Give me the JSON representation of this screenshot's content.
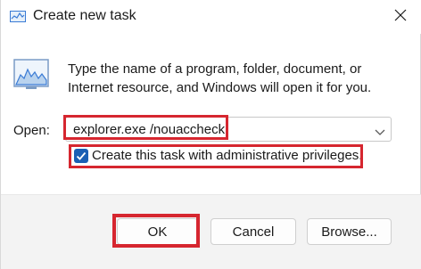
{
  "window": {
    "title": "Create new task",
    "title_icon": "task-manager-icon",
    "close_icon": "close-icon"
  },
  "content": {
    "program_icon": "performance-graph-icon",
    "description": "Type the name of a program, folder, document, or Internet resource, and Windows will open it for you.",
    "open_label": "Open:",
    "open_value": "explorer.exe /nouaccheck",
    "admin_checkbox": {
      "label": "Create this task with administrative privileges.",
      "checked": true
    }
  },
  "buttons": {
    "ok": "OK",
    "cancel": "Cancel",
    "browse": "Browse..."
  },
  "colors": {
    "highlight": "#d6262f",
    "checkbox_accent": "#1a5fb4",
    "footer_bg": "#f3f3f3"
  }
}
